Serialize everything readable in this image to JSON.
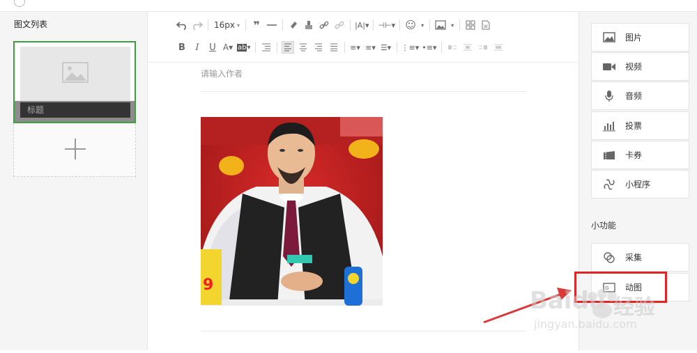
{
  "left_panel": {
    "title": "图文列表",
    "article": {
      "title": "标题"
    }
  },
  "editor": {
    "font_size": "16px",
    "author_placeholder": "请输入作者"
  },
  "right_panel": {
    "media_items": [
      {
        "label": "图片",
        "icon": "image-icon"
      },
      {
        "label": "视频",
        "icon": "video-icon"
      },
      {
        "label": "音频",
        "icon": "microphone-icon"
      },
      {
        "label": "投票",
        "icon": "bar-chart-icon"
      },
      {
        "label": "卡券",
        "icon": "coupon-icon"
      },
      {
        "label": "小程序",
        "icon": "mini-program-icon"
      }
    ],
    "small_functions_title": "小功能",
    "function_items": [
      {
        "label": "采集",
        "icon": "collect-icon"
      },
      {
        "label": "动图",
        "icon": "gif-icon"
      }
    ]
  },
  "watermark": {
    "brand": "Baidu",
    "sub": "经验",
    "url": "jingyan.baidu.com"
  },
  "colors": {
    "selected_border": "#3f9f40",
    "highlight_red": "#e02424"
  }
}
